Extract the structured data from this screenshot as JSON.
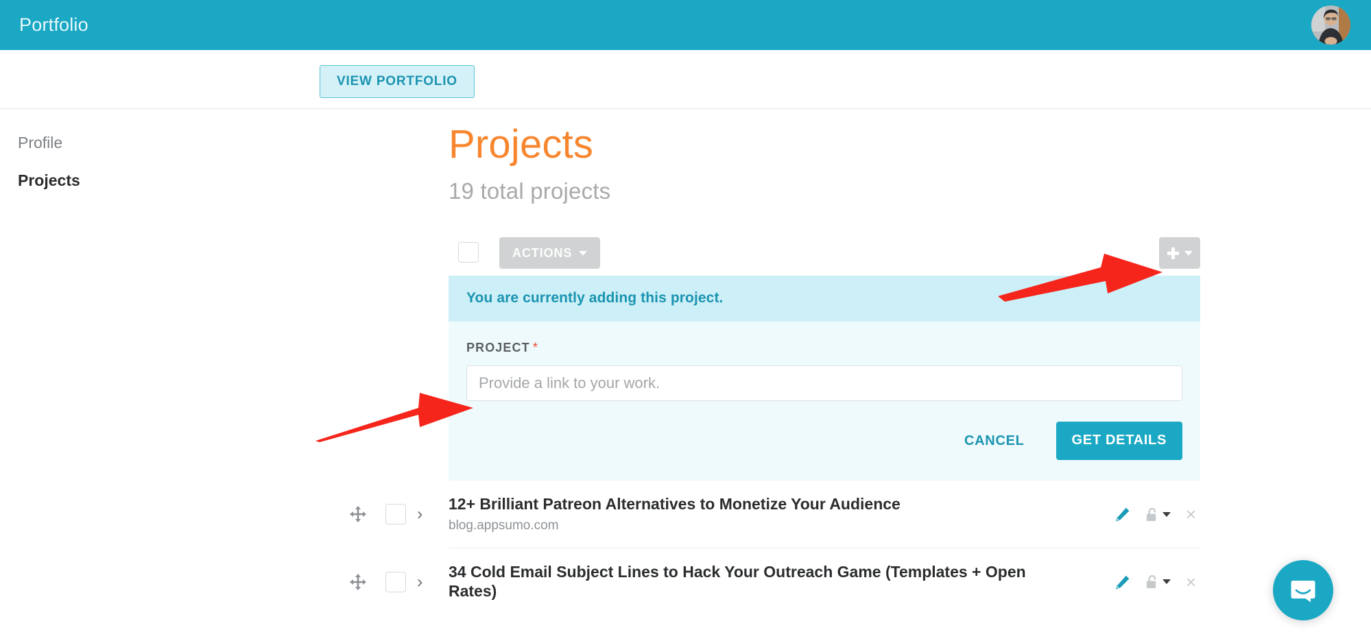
{
  "topbar": {
    "title": "Portfolio",
    "avatar_alt": "user-avatar"
  },
  "subheader": {
    "view_portfolio_label": "VIEW PORTFOLIO"
  },
  "sidebar": {
    "items": [
      {
        "label": "Profile",
        "active": false
      },
      {
        "label": "Projects",
        "active": true
      }
    ]
  },
  "main": {
    "title": "Projects",
    "subtitle": "19 total projects"
  },
  "toolbar": {
    "actions_label": "ACTIONS",
    "add_label": "+"
  },
  "add_panel": {
    "banner": "You are currently adding this project.",
    "field_label": "PROJECT",
    "required_marker": "*",
    "input_value": "",
    "input_placeholder": "Provide a link to your work.",
    "cancel_label": "CANCEL",
    "submit_label": "GET DETAILS"
  },
  "projects": [
    {
      "title": "12+ Brilliant Patreon Alternatives to Monetize Your Audience",
      "url": "blog.appsumo.com"
    },
    {
      "title": "34 Cold Email Subject Lines to Hack Your Outreach Game (Templates + Open Rates)",
      "url": ""
    }
  ],
  "row_icons": {
    "edit": "pencil-icon",
    "privacy": "unlock-icon",
    "remove": "×"
  },
  "colors": {
    "teal": "#1aa8c4",
    "teal_text": "#1a94b0",
    "orange": "#f7862f",
    "banner_bg": "#cdeff8",
    "panel_bg": "#effafc",
    "gray_button": "#d0d2d3",
    "required_red": "#ec4e3d",
    "annotation_red": "#f5251b"
  },
  "chat": {
    "launcher": "intercom-chat-icon"
  }
}
